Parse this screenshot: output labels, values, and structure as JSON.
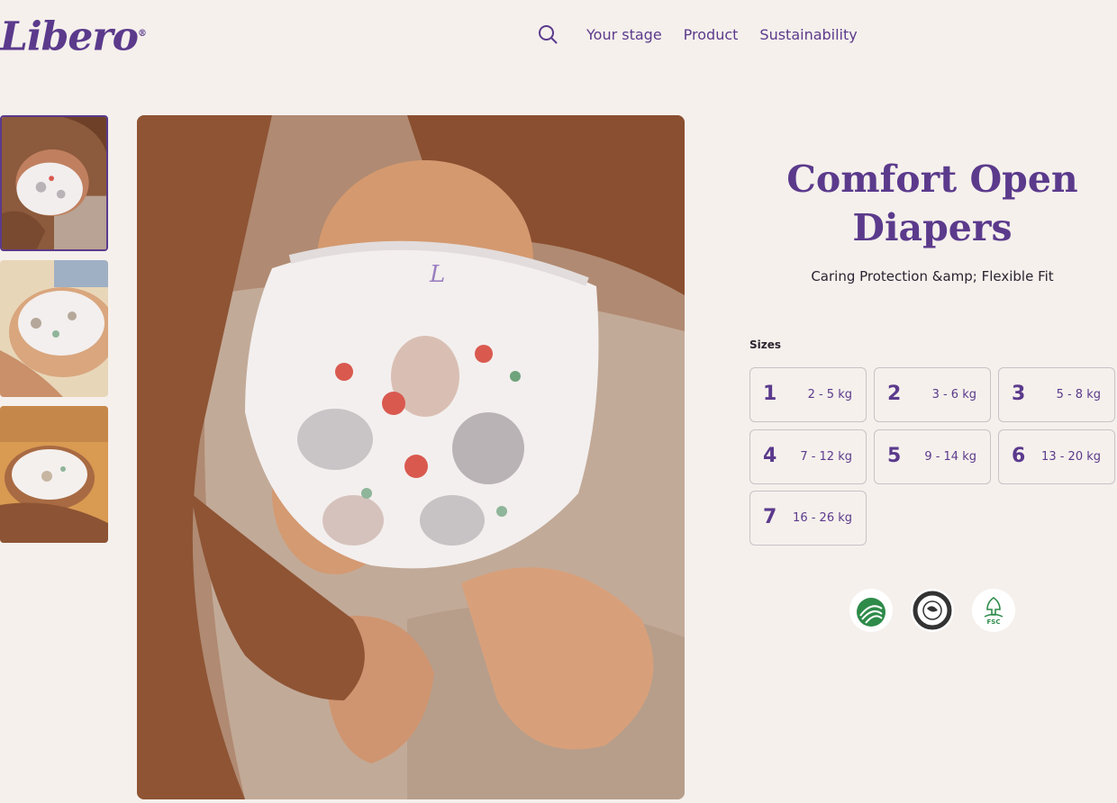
{
  "header": {
    "logo_text": "Libero",
    "logo_mark": "®",
    "nav": [
      {
        "label": "Your stage"
      },
      {
        "label": "Product"
      },
      {
        "label": "Sustainability"
      }
    ],
    "search_icon": "search-icon"
  },
  "gallery": {
    "thumbnails": [
      {
        "alt": "baby-diaper-photo-1",
        "active": true
      },
      {
        "alt": "baby-diaper-photo-2",
        "active": false
      },
      {
        "alt": "baby-diaper-photo-3",
        "active": false
      }
    ],
    "main_image": "baby-diaper-main-photo"
  },
  "product": {
    "title_line1": "Comfort Open",
    "title_line2": "Diapers",
    "subtitle": "Caring Protection &amp; Flexible Fit",
    "sizes_label": "Sizes",
    "sizes": [
      {
        "num": "1",
        "kg": "2 - 5 kg"
      },
      {
        "num": "2",
        "kg": "3 - 6 kg"
      },
      {
        "num": "3",
        "kg": "5 - 8 kg"
      },
      {
        "num": "4",
        "kg": "7 - 12 kg"
      },
      {
        "num": "5",
        "kg": "9 - 14 kg"
      },
      {
        "num": "6",
        "kg": "13 - 20 kg"
      },
      {
        "num": "7",
        "kg": "16 - 26 kg"
      }
    ],
    "certifications": [
      {
        "icon": "nordic-swan-ecolabel-icon",
        "text": "NORDIC SWAN ECOLABEL"
      },
      {
        "icon": "asthma-allergy-nordic-icon",
        "text": "ASTHMA ALLERGY NORDIC"
      },
      {
        "icon": "fsc-icon",
        "text": "FSC"
      }
    ]
  },
  "colors": {
    "background": "#f5f0ec",
    "brand_purple": "#5b3a8c",
    "text_dark": "#2b2430",
    "border": "#c9c2c7"
  }
}
